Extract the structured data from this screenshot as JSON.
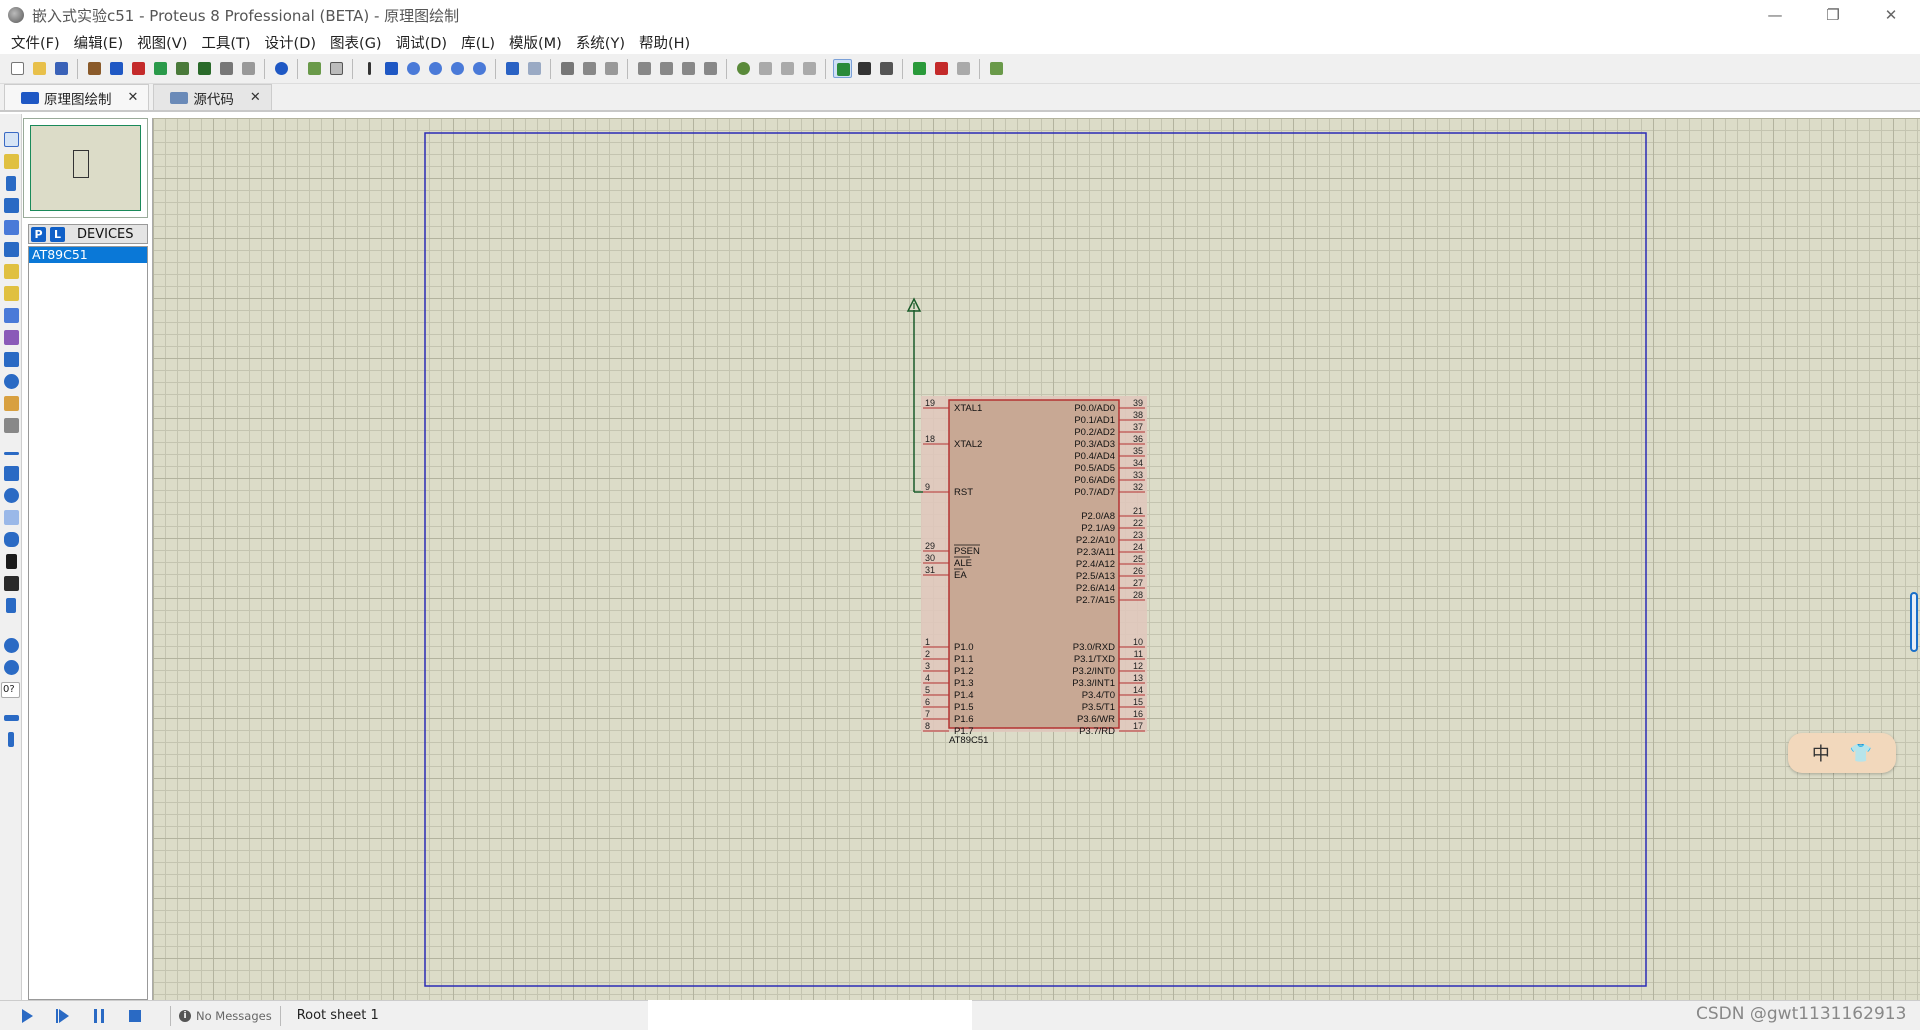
{
  "window": {
    "title": "嵌入式实验c51 - Proteus 8 Professional (BETA) - 原理图绘制",
    "controls": [
      "—",
      "❐",
      "✕"
    ]
  },
  "menu": [
    "文件(F)",
    "编辑(E)",
    "视图(V)",
    "工具(T)",
    "设计(D)",
    "图表(G)",
    "调试(D)",
    "库(L)",
    "模版(M)",
    "系统(Y)",
    "帮助(H)"
  ],
  "tabs": [
    {
      "label": "原理图绘制",
      "close": "✕",
      "active": true
    },
    {
      "label": "源代码",
      "close": "✕",
      "active": false
    }
  ],
  "devices": {
    "p_button": "P",
    "l_button": "L",
    "header": "DEVICES",
    "items": [
      "AT89C51"
    ],
    "selected": "AT89C51"
  },
  "left_tools": {
    "rotation_field": "0?"
  },
  "schematic": {
    "component": {
      "name": "AT89C51",
      "left_pins": [
        {
          "num": "19",
          "name": "XTAL1"
        },
        {
          "num": "18",
          "name": "XTAL2"
        },
        {
          "num": "9",
          "name": "RST"
        },
        {
          "num": "29",
          "name": "PSEN"
        },
        {
          "num": "30",
          "name": "ALE"
        },
        {
          "num": "31",
          "name": "EA"
        },
        {
          "num": "1",
          "name": "P1.0"
        },
        {
          "num": "2",
          "name": "P1.1"
        },
        {
          "num": "3",
          "name": "P1.2"
        },
        {
          "num": "4",
          "name": "P1.3"
        },
        {
          "num": "5",
          "name": "P1.4"
        },
        {
          "num": "6",
          "name": "P1.5"
        },
        {
          "num": "7",
          "name": "P1.6"
        },
        {
          "num": "8",
          "name": "P1.7"
        }
      ],
      "right_pins": [
        {
          "num": "39",
          "name": "P0.0/AD0"
        },
        {
          "num": "38",
          "name": "P0.1/AD1"
        },
        {
          "num": "37",
          "name": "P0.2/AD2"
        },
        {
          "num": "36",
          "name": "P0.3/AD3"
        },
        {
          "num": "35",
          "name": "P0.4/AD4"
        },
        {
          "num": "34",
          "name": "P0.5/AD5"
        },
        {
          "num": "33",
          "name": "P0.6/AD6"
        },
        {
          "num": "32",
          "name": "P0.7/AD7"
        },
        {
          "num": "21",
          "name": "P2.0/A8"
        },
        {
          "num": "22",
          "name": "P2.1/A9"
        },
        {
          "num": "23",
          "name": "P2.2/A10"
        },
        {
          "num": "24",
          "name": "P2.3/A11"
        },
        {
          "num": "25",
          "name": "P2.4/A12"
        },
        {
          "num": "26",
          "name": "P2.5/A13"
        },
        {
          "num": "27",
          "name": "P2.6/A14"
        },
        {
          "num": "28",
          "name": "P2.7/A15"
        },
        {
          "num": "10",
          "name": "P3.0/RXD"
        },
        {
          "num": "11",
          "name": "P3.1/TXD"
        },
        {
          "num": "12",
          "name": "P3.2/INT0"
        },
        {
          "num": "13",
          "name": "P3.3/INT1"
        },
        {
          "num": "14",
          "name": "P3.4/T0"
        },
        {
          "num": "15",
          "name": "P3.5/T1"
        },
        {
          "num": "16",
          "name": "P3.6/WR"
        },
        {
          "num": "17",
          "name": "P3.7/RD"
        }
      ]
    },
    "colors": {
      "background": "#dcdcc8",
      "grid": "#c4c4b0",
      "sheet_border": "#2b2bb5",
      "chip_body": "#c8a894",
      "chip_outline": "#b43232",
      "wire": "#1a5c2a"
    }
  },
  "ime": {
    "lang": "中",
    "skin": "👕"
  },
  "status": {
    "messages": "No Messages",
    "sheet": "Root sheet 1"
  },
  "watermark": "CSDN @gwt1131162913"
}
